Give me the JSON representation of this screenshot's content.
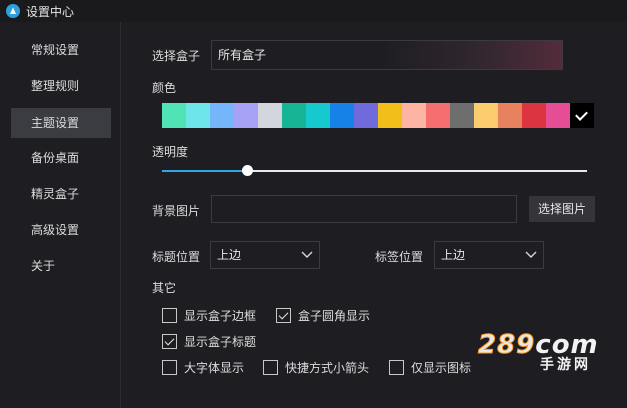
{
  "window": {
    "title": "设置中心"
  },
  "sidebar": {
    "items": [
      {
        "label": "常规设置"
      },
      {
        "label": "整理规则"
      },
      {
        "label": "主题设置",
        "active": true
      },
      {
        "label": "备份桌面"
      },
      {
        "label": "精灵盒子"
      },
      {
        "label": "高级设置"
      },
      {
        "label": "关于"
      }
    ]
  },
  "theme": {
    "select_box_label": "选择盒子",
    "select_box_value": "所有盒子",
    "color_label": "颜色",
    "colors": [
      "#4fe3b6",
      "#6ee6e9",
      "#74b6f9",
      "#a6a3f7",
      "#d4d6de",
      "#16b596",
      "#15c9cf",
      "#1681e6",
      "#6f6bdc",
      "#f2be19",
      "#fdb4a2",
      "#f46e6e",
      "#6e6e6e",
      "#fbcd6e",
      "#e8825e",
      "#dd3540",
      "#e64d95",
      "#000000"
    ],
    "selected_color_index": 17,
    "opacity_label": "透明度",
    "opacity_value": 0.2,
    "bg_image_label": "背景图片",
    "bg_image_value": "",
    "choose_image_button": "选择图片",
    "title_position_label": "标题位置",
    "title_position_value": "上边",
    "tag_position_label": "标签位置",
    "tag_position_value": "上边",
    "other_label": "其它",
    "options": [
      {
        "label": "显示盒子边框",
        "checked": false
      },
      {
        "label": "盒子圆角显示",
        "checked": true
      },
      {
        "label": "显示盒子标题",
        "checked": true
      },
      {
        "label": "大字体显示",
        "checked": false
      },
      {
        "label": "快捷方式小箭头",
        "checked": false
      },
      {
        "label": "仅显示图标",
        "checked": false
      }
    ]
  },
  "watermark": {
    "brand": "289",
    "suffix": "com",
    "sub": "手游网"
  },
  "icons": {
    "app": "app-logo-icon",
    "chevron": "chevron-down-icon",
    "check": "check-icon"
  }
}
